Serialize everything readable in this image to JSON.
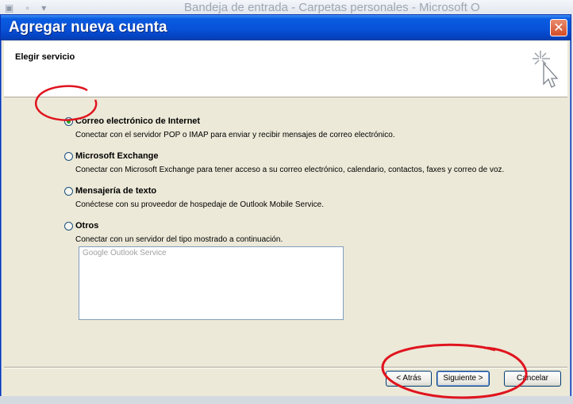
{
  "background_window": {
    "title": "Bandeja de entrada - Carpetas personales - Microsoft O"
  },
  "dialog": {
    "title": "Agregar nueva cuenta",
    "close_icon": "close-icon",
    "header": "Elegir servicio",
    "wizard_icon": "wizard-cursor-icon"
  },
  "options": [
    {
      "label": "Correo electrónico de Internet",
      "description": "Conectar con el servidor POP o IMAP para enviar y recibir mensajes de correo electrónico.",
      "selected": true
    },
    {
      "label": "Microsoft Exchange",
      "description": "Conectar con Microsoft Exchange para tener acceso a su correo electrónico, calendario, contactos, faxes y correo de voz.",
      "selected": false
    },
    {
      "label": "Mensajería de texto",
      "description": "Conéctese con su proveedor de hospedaje de Outlook Mobile Service.",
      "selected": false
    },
    {
      "label": "Otros",
      "description": "Conectar con un servidor del tipo mostrado a continuación.",
      "selected": false
    }
  ],
  "other_services": [
    "Google Outlook Service"
  ],
  "buttons": {
    "back": "< Atrás",
    "next": "Siguiente >",
    "cancel": "Cancelar"
  },
  "colors": {
    "titlebar": "#0852d8",
    "annotation_red": "#e0141e",
    "dialog_bg": "#ece9d8"
  }
}
